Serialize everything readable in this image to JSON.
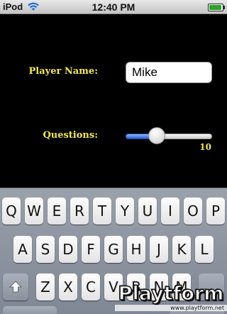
{
  "status_bar": {
    "carrier": "iPod",
    "time": "12:40 PM",
    "battery_level": 1.0,
    "battery_color": "#2fa12a"
  },
  "form": {
    "player_name_label": "Player Name:",
    "player_name_value": "Mike",
    "questions_label": "Questions:",
    "questions_value": "10",
    "slider_fraction": 0.36,
    "label_color": "#f2e84b"
  },
  "keyboard": {
    "row1": [
      "Q",
      "W",
      "E",
      "R",
      "T",
      "Y",
      "U",
      "I",
      "O",
      "P"
    ],
    "row2": [
      "A",
      "S",
      "D",
      "F",
      "G",
      "H",
      "J",
      "K",
      "L"
    ],
    "row3": [
      "Z",
      "X",
      "C",
      "V",
      "B",
      "N",
      "M"
    ],
    "shift_icon": "shift-arrow-icon"
  },
  "watermark": {
    "logo": "Playtform",
    "url": "www.playtform.net"
  }
}
